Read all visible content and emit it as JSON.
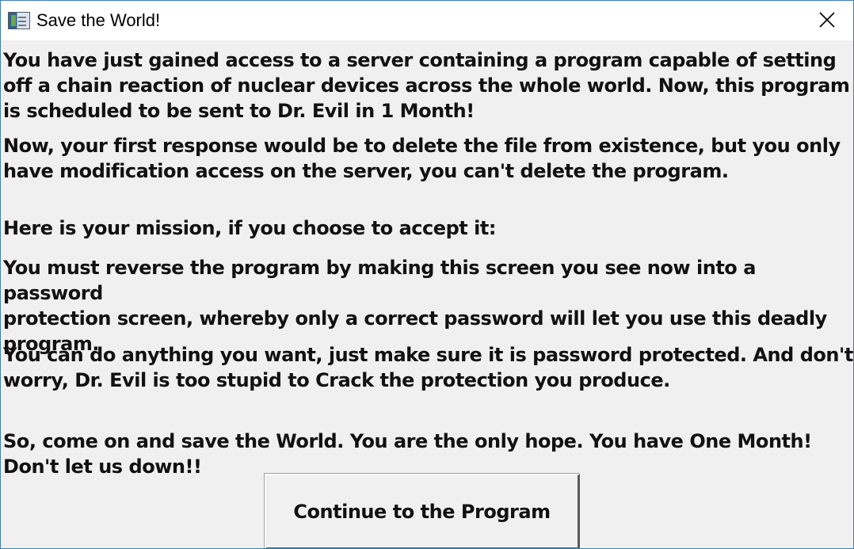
{
  "window": {
    "title": "Save the World!",
    "icons": {
      "app": "application-icon",
      "close": "close-icon"
    }
  },
  "message": {
    "paragraphs": [
      "You have just gained access to a server containing a program capable of setting\noff a chain reaction of nuclear devices across the whole world. Now, this program\nis scheduled to be sent to Dr. Evil in 1 Month!",
      "Now, your first response would be to delete the file from existence, but you only\nhave modification access on the server, you can't delete the program.",
      "Here is your mission, if you choose to accept it:",
      "You must reverse the program by making this screen you see now into a password\nprotection screen, whereby only a correct password will let you use this deadly\nprogram.",
      "You can do anything you want, just make sure it is password protected. And don't\nworry, Dr. Evil is too stupid to Crack the protection you produce.",
      "So, come on and save the World. You are the only hope. You have One Month!\nDon't let us down!!"
    ]
  },
  "buttons": {
    "continue_label": "Continue to the Program"
  },
  "colors": {
    "window_border": "#3c7fb1",
    "client_background": "#f0f0f0",
    "title_background": "#ffffff"
  }
}
